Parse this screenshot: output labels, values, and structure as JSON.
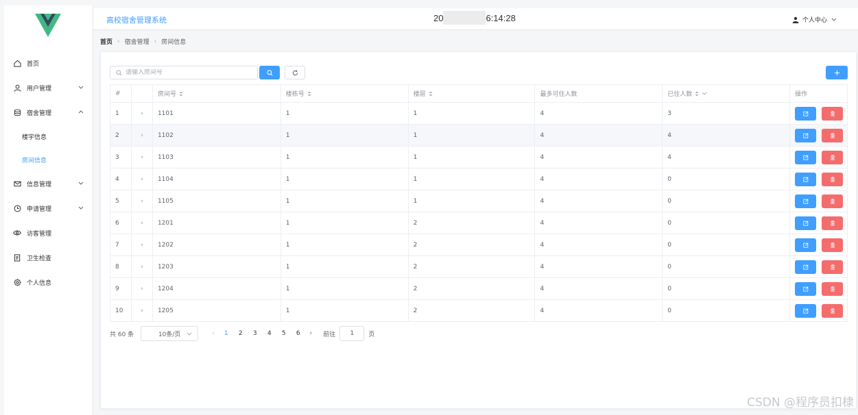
{
  "app": {
    "title": "高校宿舍管理系统",
    "clock_prefix": "20",
    "clock_suffix": "6:14:28",
    "user_center": "个人中心"
  },
  "colors": {
    "primary": "#409eff",
    "danger": "#f56c6c",
    "logo_green": "#41b883",
    "logo_dark": "#34495e"
  },
  "sidebar": {
    "items": [
      {
        "label": "首页",
        "icon": "home-icon"
      },
      {
        "label": "用户管理",
        "icon": "user-icon",
        "expandable": true
      },
      {
        "label": "宿舍管理",
        "icon": "database-icon",
        "expanded": true
      },
      {
        "label": "信息管理",
        "icon": "message-icon",
        "expandable": true
      },
      {
        "label": "申请管理",
        "icon": "clock-icon",
        "expandable": true
      },
      {
        "label": "访客管理",
        "icon": "eye-icon"
      },
      {
        "label": "卫生检查",
        "icon": "document-icon"
      },
      {
        "label": "个人信息",
        "icon": "setting-icon"
      }
    ],
    "submenu": [
      {
        "label": "楼宇信息",
        "active": false
      },
      {
        "label": "房间信息",
        "active": true
      }
    ]
  },
  "breadcrumb": [
    "首页",
    "宿舍管理",
    "房间信息"
  ],
  "search": {
    "placeholder": "请输入房间号"
  },
  "table": {
    "headers": [
      "#",
      "",
      "房间号",
      "楼栋号",
      "楼层",
      "最多可住人数",
      "已住人数",
      "操作"
    ],
    "rows": [
      [
        "1",
        "1101",
        "1",
        "1",
        "4",
        "3"
      ],
      [
        "2",
        "1102",
        "1",
        "1",
        "4",
        "4"
      ],
      [
        "3",
        "1103",
        "1",
        "1",
        "4",
        "4"
      ],
      [
        "4",
        "1104",
        "1",
        "1",
        "4",
        "0"
      ],
      [
        "5",
        "1105",
        "1",
        "1",
        "4",
        "0"
      ],
      [
        "6",
        "1201",
        "1",
        "2",
        "4",
        "0"
      ],
      [
        "7",
        "1202",
        "1",
        "2",
        "4",
        "0"
      ],
      [
        "8",
        "1203",
        "1",
        "2",
        "4",
        "0"
      ],
      [
        "9",
        "1204",
        "1",
        "2",
        "4",
        "0"
      ],
      [
        "10",
        "1205",
        "1",
        "2",
        "4",
        "0"
      ]
    ]
  },
  "pagination": {
    "total": "共 60 条",
    "page_size": "10条/页",
    "pages": [
      "1",
      "2",
      "3",
      "4",
      "5",
      "6"
    ],
    "current": "1",
    "jump_label": "前往",
    "jump_value": "1",
    "jump_suffix": "页"
  },
  "watermark": "CSDN @程序员扣棣"
}
